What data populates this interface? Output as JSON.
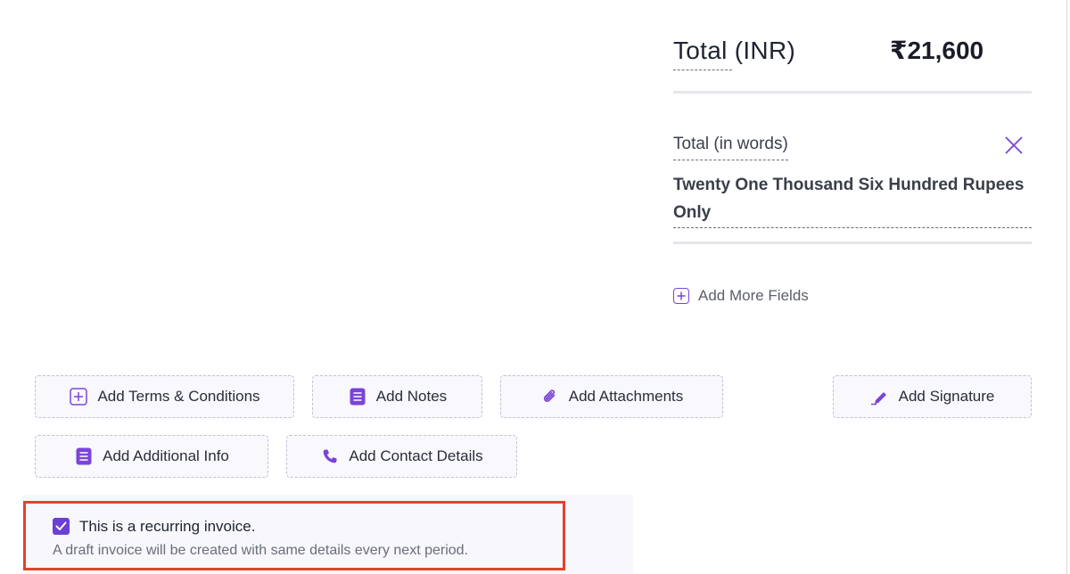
{
  "totals": {
    "total_label": "Total (INR)",
    "total_amount": "₹21,600",
    "words_label": "Total (in words)",
    "words_value": "Twenty One Thousand Six Hundred Rupees Only",
    "add_more_label": "Add More Fields"
  },
  "actions": {
    "terms_label": "Add Terms & Conditions",
    "notes_label": "Add Notes",
    "attachments_label": "Add Attachments",
    "signature_label": "Add Signature",
    "additional_info_label": "Add Additional Info",
    "contact_details_label": "Add Contact Details"
  },
  "recurring": {
    "checked": true,
    "title": "This is a recurring invoice.",
    "subtitle": "A draft invoice will be created with same details every next period."
  },
  "colors": {
    "accent": "#6b3fd4",
    "highlight_frame": "#e0432b"
  },
  "icons": [
    "plus-square-icon",
    "close-icon",
    "note-icon",
    "paperclip-icon",
    "pen-icon",
    "phone-icon",
    "checkbox-checked-icon"
  ]
}
